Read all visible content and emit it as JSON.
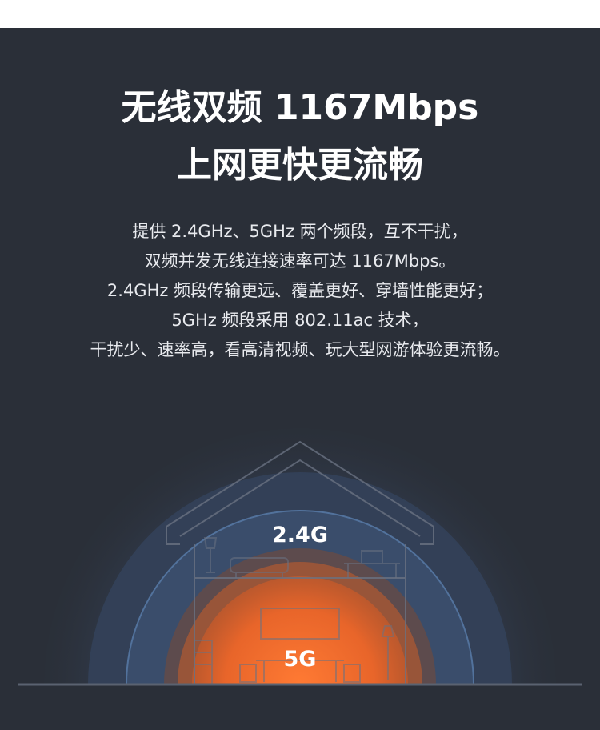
{
  "header": {
    "title_line1": "无线双频 1167Mbps",
    "title_line2": "上网更快更流畅"
  },
  "description": {
    "lines": [
      "提供 2.4GHz、5GHz 两个频段，互不干扰，",
      "双频并发无线连接速率可达 1167Mbps。",
      "2.4GHz 频段传输更远、覆盖更好、穿墙性能更好；",
      "5GHz 频段采用 802.11ac 技术，",
      "干扰少、速率高，看高清视频、玩大型网游体验更流畅。"
    ]
  },
  "illustration": {
    "band_24g_label": "2.4G",
    "band_5g_label": "5G",
    "colors": {
      "background": "#2a2f38",
      "wave_24g": "#3a4f6e",
      "wave_5g": "#e8652a",
      "house_line": "#5a6270"
    }
  }
}
